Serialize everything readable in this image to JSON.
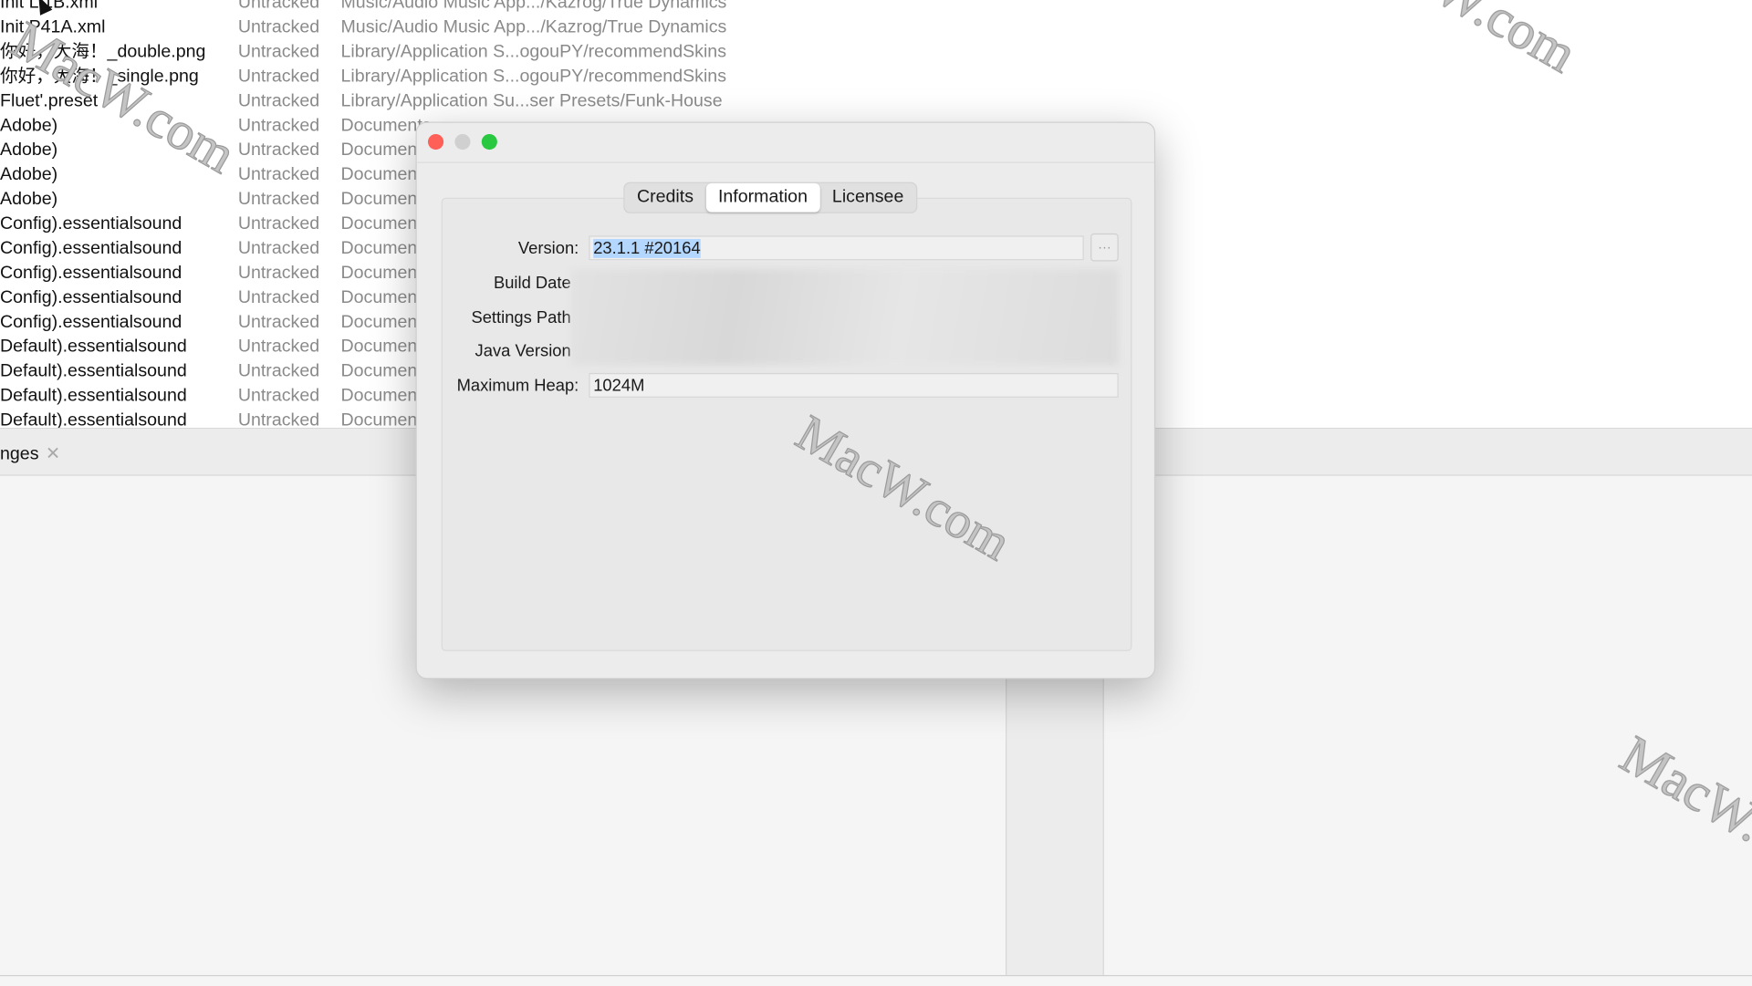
{
  "file_list": [
    {
      "name": "Init L 1B.xml",
      "status": "Untracked",
      "path": "Music/Audio Music App.../Kazrog/True Dynamics"
    },
    {
      "name": "Init P41A.xml",
      "status": "Untracked",
      "path": "Music/Audio Music App.../Kazrog/True Dynamics"
    },
    {
      "name": "你好，大海！_double.png",
      "status": "Untracked",
      "path": "Library/Application S...ogouPY/recommendSkins"
    },
    {
      "name": "你好，大海！_single.png",
      "status": "Untracked",
      "path": "Library/Application S...ogouPY/recommendSkins"
    },
    {
      "name": "Fluet'.preset",
      "status": "Untracked",
      "path": "Library/Application Su...ser Presets/Funk-House"
    },
    {
      "name": "Adobe)",
      "status": "Untracked",
      "path": "Documents"
    },
    {
      "name": "Adobe)",
      "status": "Untracked",
      "path": "Documents"
    },
    {
      "name": "Adobe)",
      "status": "Untracked",
      "path": "Documents"
    },
    {
      "name": "Adobe)",
      "status": "Untracked",
      "path": "Documents"
    },
    {
      "name": "Config).essentialsound",
      "status": "Untracked",
      "path": "Documents"
    },
    {
      "name": "Config).essentialsound",
      "status": "Untracked",
      "path": "Documents"
    },
    {
      "name": "Config).essentialsound",
      "status": "Untracked",
      "path": "Documents"
    },
    {
      "name": "Config).essentialsound",
      "status": "Untracked",
      "path": "Documents"
    },
    {
      "name": "Config).essentialsound",
      "status": "Untracked",
      "path": "Documents"
    },
    {
      "name": "Default).essentialsound",
      "status": "Untracked",
      "path": "Documents"
    },
    {
      "name": "Default).essentialsound",
      "status": "Untracked",
      "path": "Documents"
    },
    {
      "name": "Default).essentialsound",
      "status": "Untracked",
      "path": "Documents"
    },
    {
      "name": "Default).essentialsound",
      "status": "Untracked",
      "path": "Documents"
    }
  ],
  "bottom_panel": {
    "tab_label": "nges",
    "close_glyph": "✕"
  },
  "dialog": {
    "tabs": [
      {
        "label": "Credits"
      },
      {
        "label": "Information",
        "active": true
      },
      {
        "label": "Licensee"
      }
    ],
    "fields": {
      "version_label": "Version:",
      "version_value": "23.1.1 #20164",
      "build_date_label": "Build Date",
      "settings_path_label": "Settings Path",
      "java_version_label": "Java Version",
      "max_heap_label": "Maximum Heap:",
      "max_heap_value": "1024M"
    },
    "more_button": "···",
    "traffic_colors": {
      "close": "#fe5f57",
      "minimize": "#d0d0d0",
      "zoom": "#28c840"
    }
  },
  "watermark": "MacW.com"
}
